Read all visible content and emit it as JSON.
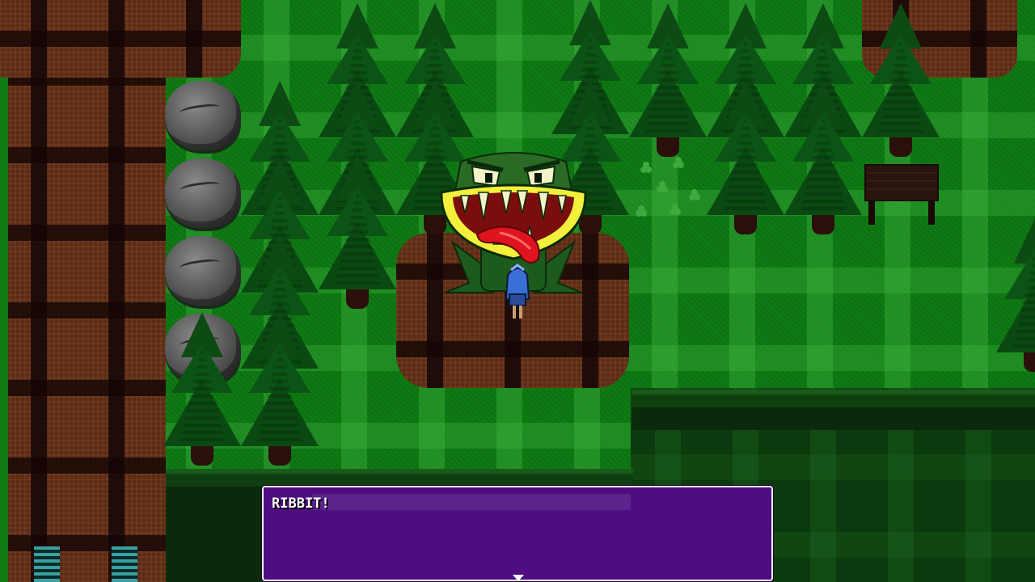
{
  "dialog": {
    "text": "RIBBIT!",
    "continue_icon": "triangle-down-icon"
  },
  "colors": {
    "dialog_bg": "#4e0d80",
    "dialog_border": "#f2ecff",
    "grass": "#0f7a14",
    "dirt": "#5a2c16",
    "frog_mouth": "#f2f03a",
    "frog_tongue": "#e0141e",
    "player": "#3a6fd6"
  },
  "scene": {
    "enemy": "frog-monster",
    "player": "blue-haired-character",
    "props": [
      "pine-trees",
      "boulders",
      "wooden-bench",
      "clover-patch",
      "stairs"
    ]
  }
}
